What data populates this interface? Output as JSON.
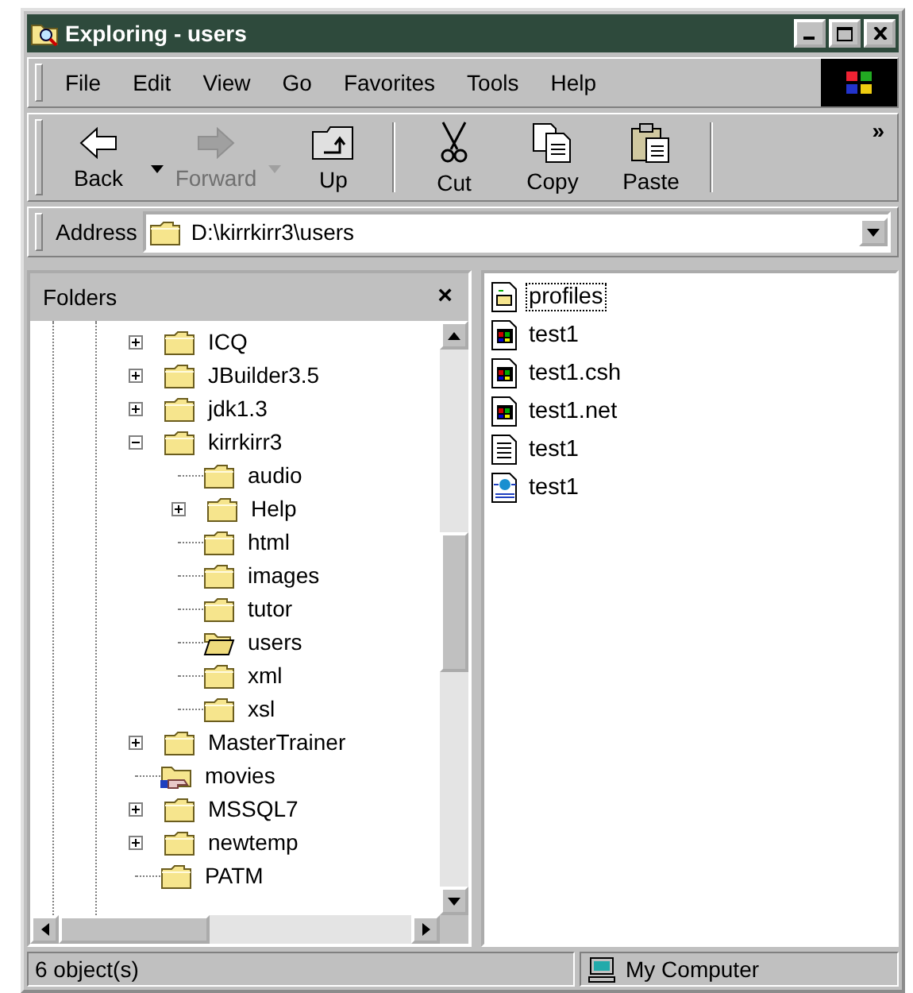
{
  "window": {
    "title": "Exploring - users"
  },
  "menu": [
    {
      "label": "File"
    },
    {
      "label": "Edit"
    },
    {
      "label": "View"
    },
    {
      "label": "Go"
    },
    {
      "label": "Favorites"
    },
    {
      "label": "Tools"
    },
    {
      "label": "Help"
    }
  ],
  "toolbar": {
    "buttons": [
      {
        "label": "Back",
        "kind": "back",
        "disabled": false,
        "dropdown": true
      },
      {
        "label": "Forward",
        "kind": "forward",
        "disabled": true,
        "dropdown": true
      },
      {
        "label": "Up",
        "kind": "up",
        "disabled": false,
        "dropdown": false
      },
      {
        "label": "Cut",
        "kind": "cut",
        "disabled": false,
        "dropdown": false
      },
      {
        "label": "Copy",
        "kind": "copy",
        "disabled": false,
        "dropdown": false
      },
      {
        "label": "Paste",
        "kind": "paste",
        "disabled": false,
        "dropdown": false
      }
    ],
    "more": "»"
  },
  "address": {
    "label": "Address",
    "value": "D:\\kirrkirr3\\users"
  },
  "folders": {
    "title": "Folders",
    "close": "×",
    "tree": [
      {
        "label": "ICQ",
        "kind": "folder",
        "expanded": false
      },
      {
        "label": "JBuilder3.5",
        "kind": "folder",
        "expanded": false
      },
      {
        "label": "jdk1.3",
        "kind": "folder",
        "expanded": false
      },
      {
        "label": "kirrkirr3",
        "kind": "folder",
        "expanded": true,
        "children": [
          {
            "label": "audio",
            "kind": "folder"
          },
          {
            "label": "Help",
            "kind": "folder",
            "expanded": false
          },
          {
            "label": "html",
            "kind": "folder"
          },
          {
            "label": "images",
            "kind": "folder"
          },
          {
            "label": "tutor",
            "kind": "folder"
          },
          {
            "label": "users",
            "kind": "open"
          },
          {
            "label": "xml",
            "kind": "folder"
          },
          {
            "label": "xsl",
            "kind": "folder"
          }
        ]
      },
      {
        "label": "MasterTrainer",
        "kind": "folder",
        "expanded": false
      },
      {
        "label": "movies",
        "kind": "shared"
      },
      {
        "label": "MSSQL7",
        "kind": "folder",
        "expanded": false
      },
      {
        "label": "newtemp",
        "kind": "folder",
        "expanded": false
      },
      {
        "label": "PATM",
        "kind": "folder"
      }
    ]
  },
  "files": [
    {
      "name": "profiles",
      "kind": "shortcut",
      "focused": true
    },
    {
      "name": "test1",
      "kind": "program",
      "focused": false
    },
    {
      "name": "test1.csh",
      "kind": "program",
      "focused": false
    },
    {
      "name": "test1.net",
      "kind": "program",
      "focused": false
    },
    {
      "name": "test1",
      "kind": "text",
      "focused": false
    },
    {
      "name": "test1",
      "kind": "web",
      "focused": false
    }
  ],
  "status_bar": {
    "count": "6 object(s)",
    "zone": "My Computer"
  }
}
